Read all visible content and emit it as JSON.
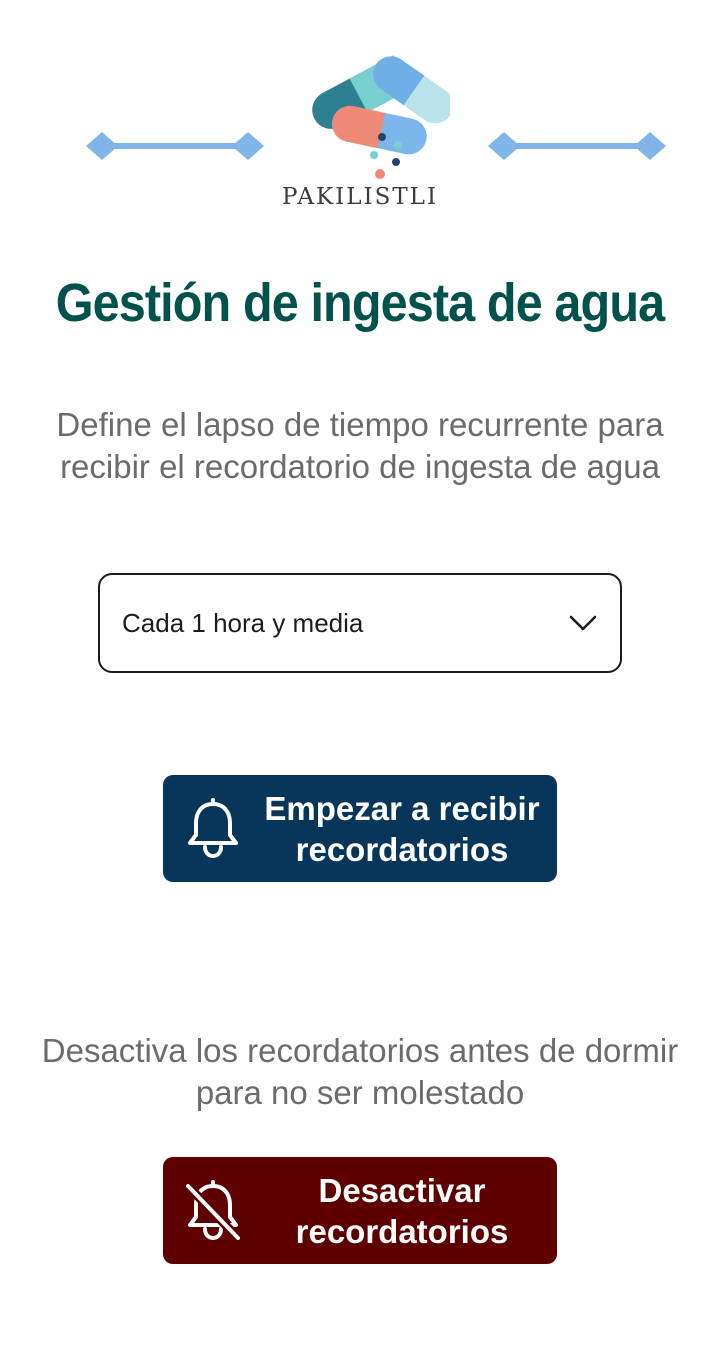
{
  "header": {
    "brand": "PAKILISTLI",
    "logo_icon": "pills-logo-icon",
    "decorations": [
      "diamond-line-left-icon",
      "diamond-line-right-icon"
    ]
  },
  "title": "Gestión de ingesta de agua",
  "interval": {
    "description": "Define el lapso de tiempo recurrente para recibir el recordatorio de ingesta de agua",
    "selected": "Cada 1 hora y media",
    "icon": "chevron-down-icon"
  },
  "start_button": {
    "label": "Empezar a recibir\nrecordatorios",
    "icon": "bell-icon",
    "color": "#07365a"
  },
  "sleep": {
    "description": "Desactiva los recordatorios antes de dormir para no ser molestado"
  },
  "stop_button": {
    "label": "Desactivar\nrecordatorios",
    "icon": "bell-off-icon",
    "color": "#5e0000"
  },
  "colors": {
    "title": "#00524a",
    "text": "#6b6b6b",
    "accent_blue": "#7fb5e8"
  }
}
